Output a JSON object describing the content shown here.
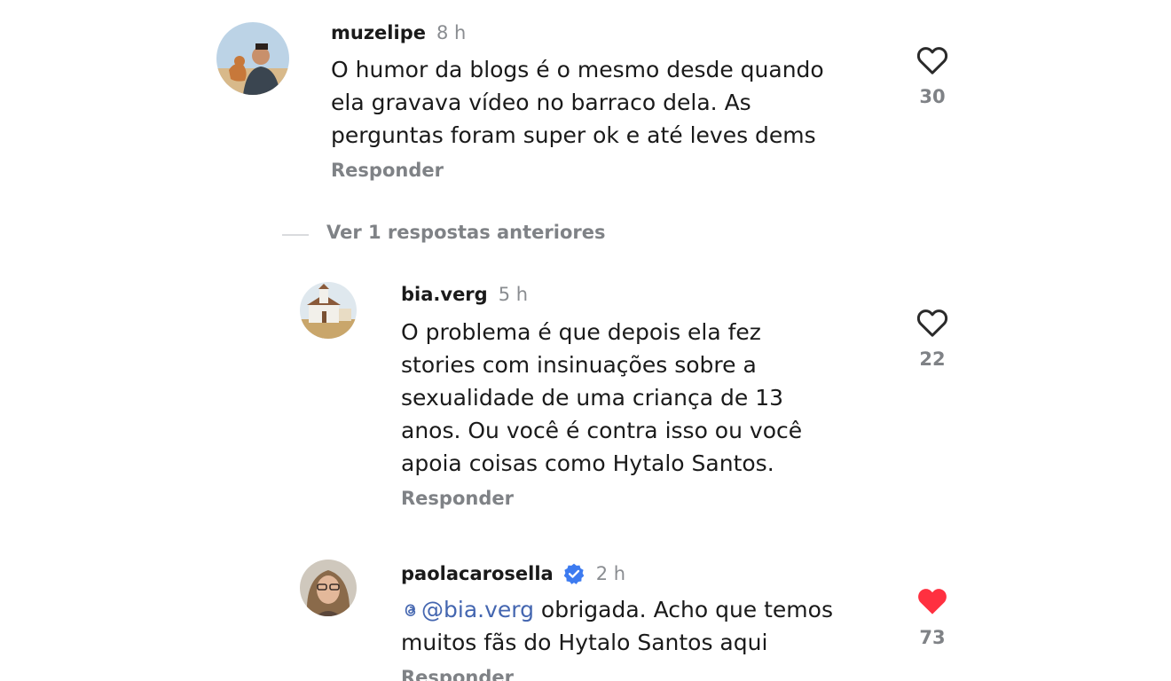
{
  "comments": [
    {
      "username": "muzelipe",
      "time": "8 h",
      "text": "O humor da blogs é o mesmo desde quando\nela gravava vídeo no barraco dela. As\nperguntas foram super ok e até leves dems",
      "reply_label": "Responder",
      "likes": "30",
      "liked": false,
      "avatar_icon": "user-with-dog-photo"
    },
    {
      "username": "bia.verg",
      "time": "5 h",
      "text": "O problema é que depois ela fez\nstories com insinuações sobre a\nsexualidade de uma criança de 13\nanos. Ou você é contra isso ou você\napoia coisas como Hytalo Santos.",
      "reply_label": "Responder",
      "likes": "22",
      "liked": false,
      "avatar_icon": "church-photo"
    },
    {
      "username": "paolacarosella",
      "verified": true,
      "time": "2 h",
      "mention": "@bia.verg",
      "text": " obrigada. Acho que temos\nmuitos fãs do Hytalo Santos aqui",
      "reply_label": "Responder",
      "likes": "73",
      "liked": true,
      "avatar_icon": "woman-photo"
    }
  ],
  "thread": {
    "view_previous_label": "Ver 1 respostas anteriores"
  },
  "colors": {
    "liked_heart": "#ff3040",
    "verified_badge": "#3d7bf0",
    "mention": "#4466b0",
    "muted": "#7f8286"
  },
  "icons": {
    "like": "heart-outline-icon",
    "liked": "heart-filled-icon",
    "verified": "verified-badge-icon",
    "thread_mention": "threads-logo-icon"
  }
}
